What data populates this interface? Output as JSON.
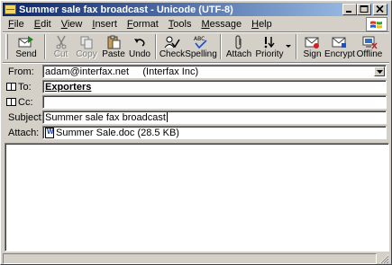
{
  "window": {
    "title": "Summer sale fax broadcast - Unicode (UTF-8)",
    "title_icon": "envelope-icon",
    "controls": [
      "minimize-icon",
      "maximize-icon",
      "close-icon"
    ]
  },
  "menu": {
    "items": [
      {
        "label": "File",
        "underline": "F",
        "rest": "ile"
      },
      {
        "label": "Edit",
        "underline": "E",
        "rest": "dit"
      },
      {
        "label": "View",
        "underline": "V",
        "rest": "iew"
      },
      {
        "label": "Insert",
        "underline": "I",
        "rest": "nsert"
      },
      {
        "label": "Format",
        "underline": "F",
        "rest": "ormat"
      },
      {
        "label": "Tools",
        "underline": "T",
        "rest": "ools"
      },
      {
        "label": "Message",
        "underline": "M",
        "rest": "essage"
      },
      {
        "label": "Help",
        "underline": "H",
        "rest": "elp"
      }
    ]
  },
  "toolbar": {
    "send": "Send",
    "cut": "Cut",
    "copy": "Copy",
    "paste": "Paste",
    "undo": "Undo",
    "check": "Check",
    "spelling": "Spelling",
    "attach": "Attach",
    "priority": "Priority",
    "sign": "Sign",
    "encrypt": "Encrypt",
    "offline": "Offline"
  },
  "fields": {
    "from_label": "From:",
    "from_value": "adam@interfax.net     (Interfax Inc)",
    "to_label": "To:",
    "to_value": "Exporters",
    "cc_label": "Cc:",
    "cc_value": "",
    "subject_label": "Subject:",
    "subject_value": "Summer sale fax broadcast",
    "attach_label": "Attach:",
    "attach_value": "Summer Sale.doc (28.5 KB)"
  },
  "colors": {
    "titlebar_start": "#0a246a",
    "titlebar_end": "#a6caf0",
    "face": "#d4d0c8"
  }
}
